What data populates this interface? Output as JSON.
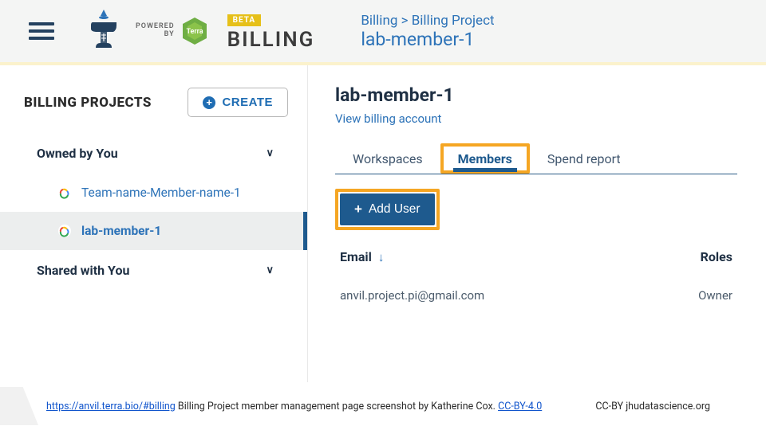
{
  "header": {
    "powered_line1": "POWERED",
    "powered_line2": "BY",
    "terra_label": "Terra",
    "beta": "BETA",
    "page_title": "BILLING",
    "breadcrumb": "Billing > Billing Project",
    "project_name": "lab-member-1"
  },
  "sidebar": {
    "title": "BILLING PROJECTS",
    "create_label": "CREATE",
    "groups": [
      {
        "label": "Owned by You"
      },
      {
        "label": "Shared with You"
      }
    ],
    "projects": [
      {
        "label": "Team-name-Member-name-1",
        "selected": false
      },
      {
        "label": "lab-member-1",
        "selected": true
      }
    ]
  },
  "content": {
    "title": "lab-member-1",
    "view_billing": "View billing account",
    "tabs": [
      {
        "label": "Workspaces"
      },
      {
        "label": "Members"
      },
      {
        "label": "Spend report"
      }
    ],
    "add_user": "Add User",
    "columns": {
      "email": "Email",
      "roles": "Roles"
    },
    "rows": [
      {
        "email": "anvil.project.pi@gmail.com",
        "role": "Owner"
      }
    ]
  },
  "footer": {
    "url": "https://anvil.terra.bio/#billing",
    "caption_mid": " Billing Project member management page screenshot by Katherine Cox.  ",
    "license": "CC-BY-4.0",
    "right": "CC-BY  jhudatascience.org"
  }
}
